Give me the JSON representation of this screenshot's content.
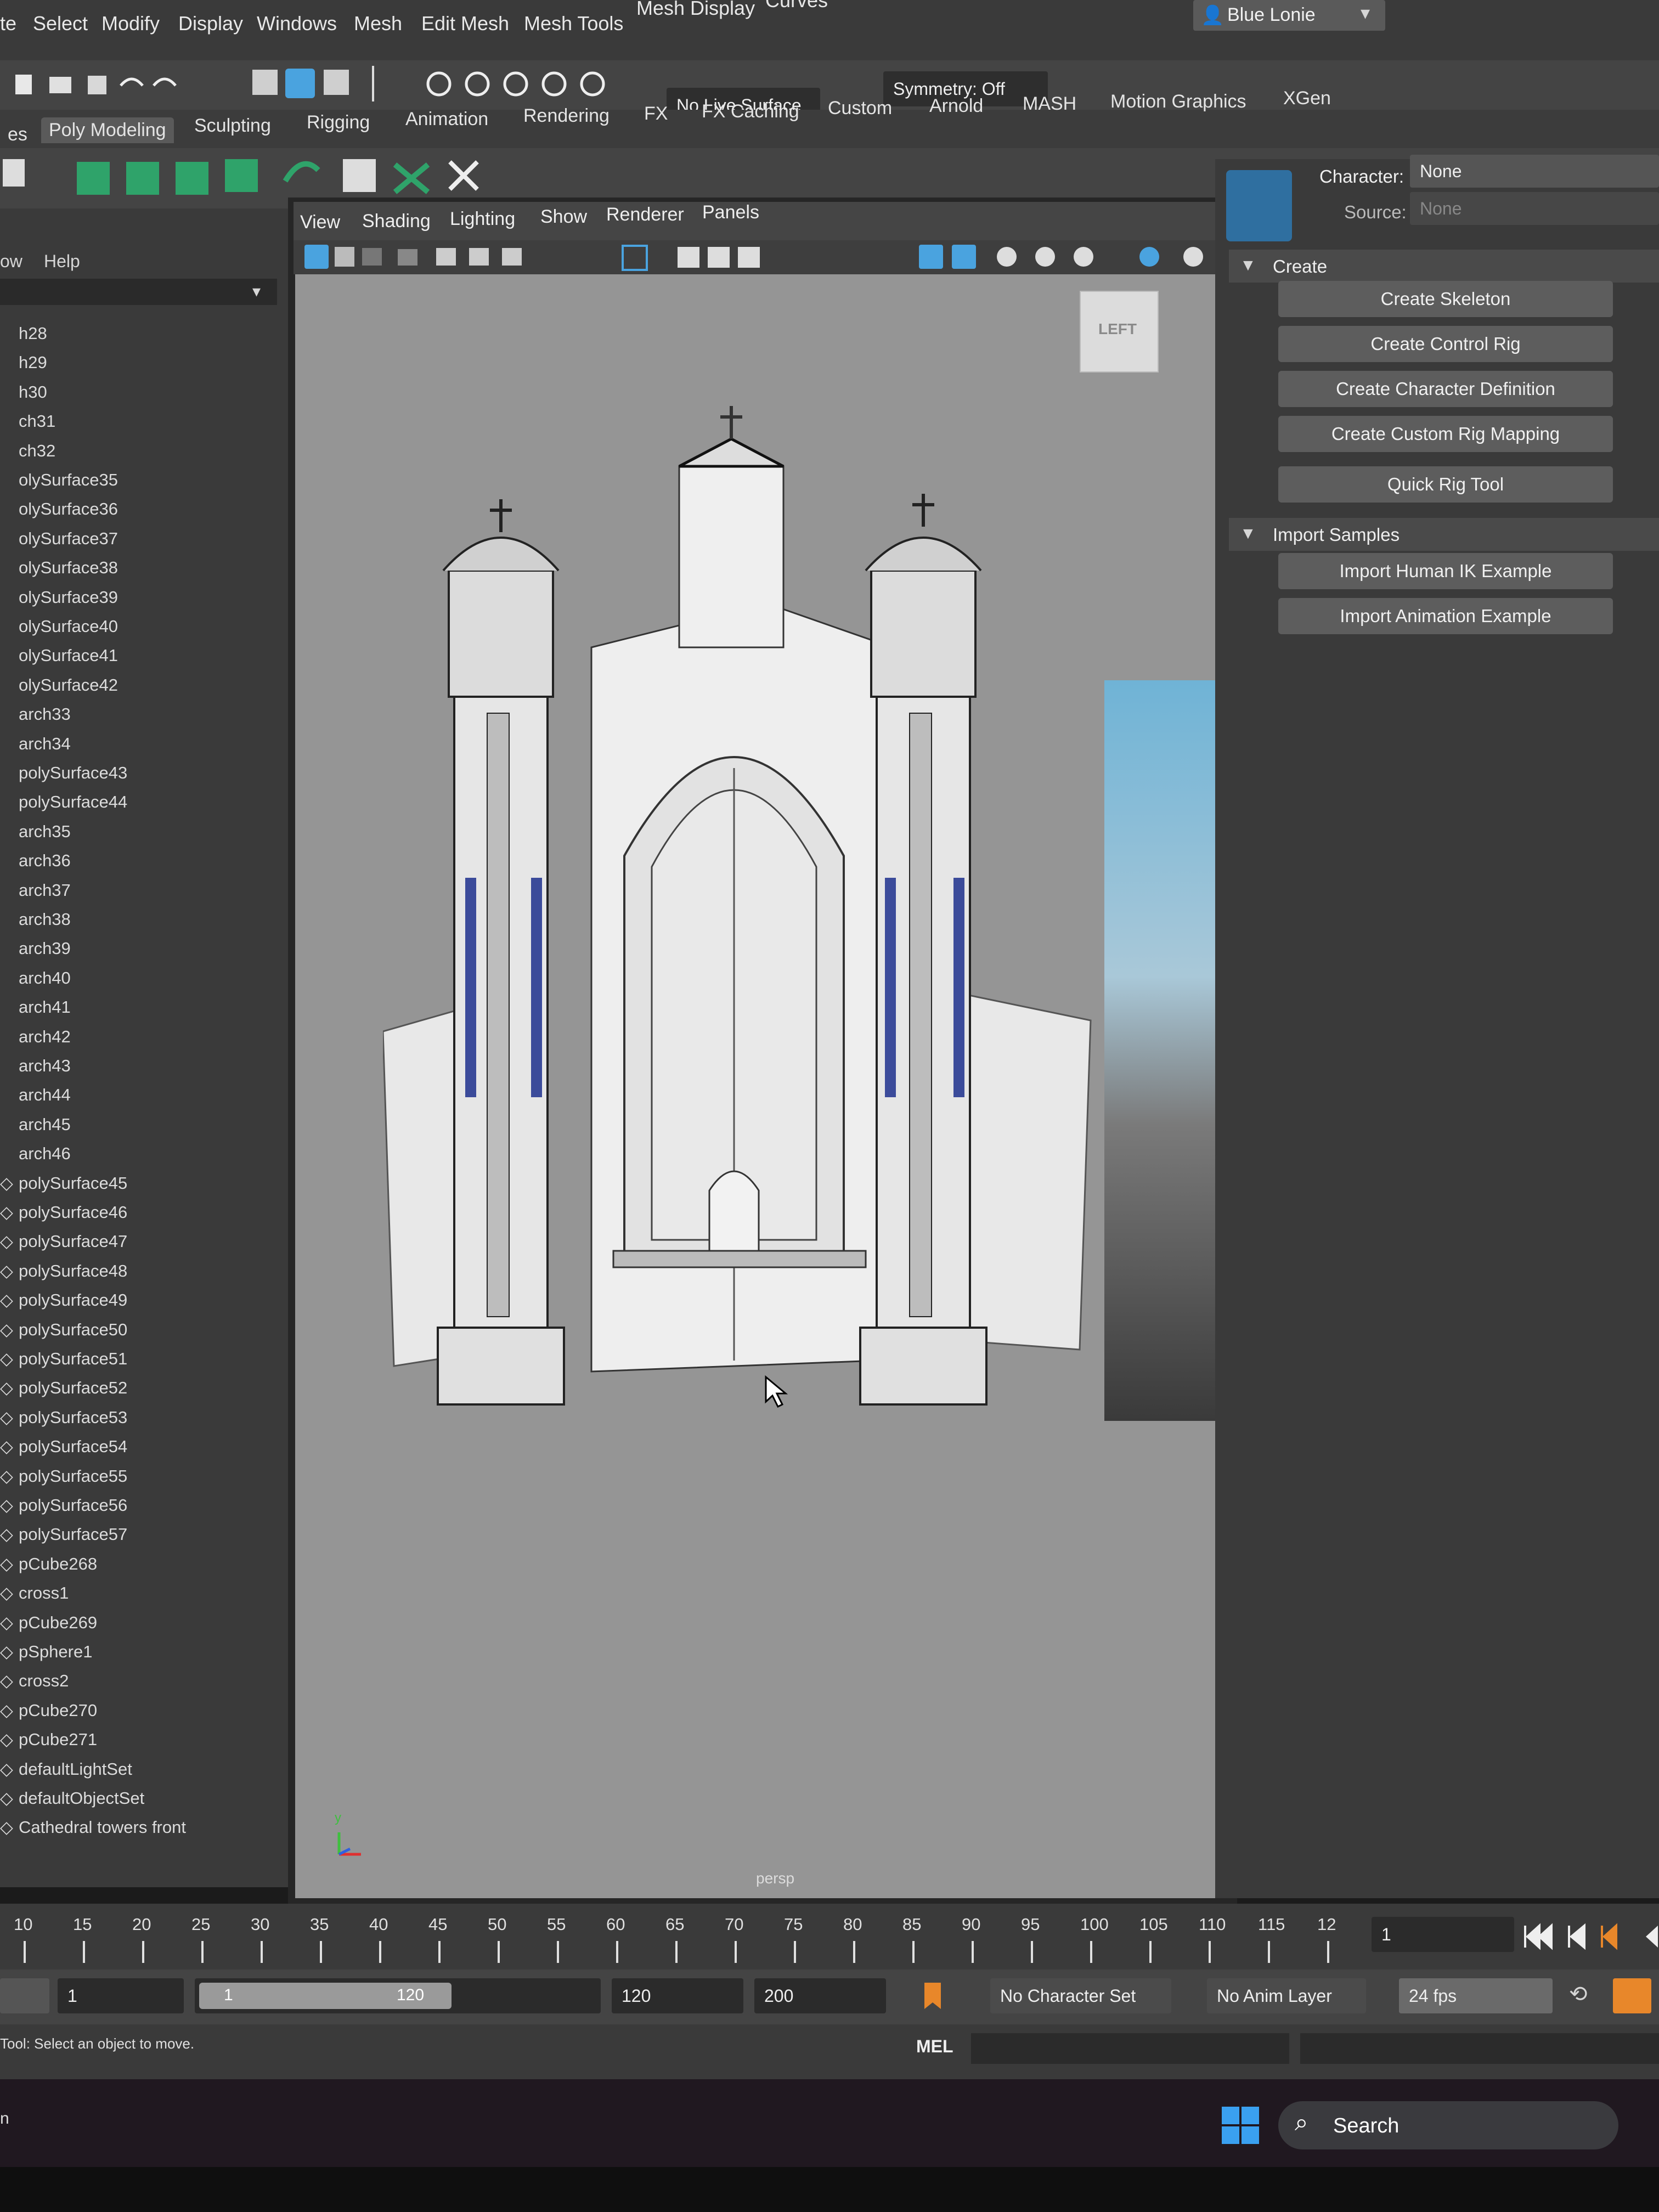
{
  "menubar": {
    "items": [
      "te",
      "Select",
      "Modify",
      "Display",
      "Windows",
      "Mesh",
      "Edit Mesh",
      "Mesh Tools",
      "Mesh Display",
      "Curves"
    ],
    "account": "Blue Lonie"
  },
  "statusline": {
    "live_surface": "No Live Surface",
    "symmetry": "Symmetry: Off"
  },
  "shelf": {
    "tabs": [
      "es",
      "Poly Modeling",
      "Sculpting",
      "Rigging",
      "Animation",
      "Rendering",
      "FX",
      "FX Caching",
      "Custom",
      "Arnold",
      "MASH",
      "Motion Graphics",
      "XGen"
    ],
    "active_tab": "Poly Modeling"
  },
  "outliner": {
    "menu": [
      "ow",
      "Help"
    ],
    "items": [
      "h28",
      "h29",
      "h30",
      "ch31",
      "ch32",
      "olySurface35",
      "olySurface36",
      "olySurface37",
      "olySurface38",
      "olySurface39",
      "olySurface40",
      "olySurface41",
      "olySurface42",
      "arch33",
      "arch34",
      "polySurface43",
      "polySurface44",
      "arch35",
      "arch36",
      "arch37",
      "arch38",
      "arch39",
      "arch40",
      "arch41",
      "arch42",
      "arch43",
      "arch44",
      "arch45",
      "arch46",
      "polySurface45",
      "polySurface46",
      "polySurface47",
      "polySurface48",
      "polySurface49",
      "polySurface50",
      "polySurface51",
      "polySurface52",
      "polySurface53",
      "polySurface54",
      "polySurface55",
      "polySurface56",
      "polySurface57",
      "pCube268",
      "cross1",
      "pCube269",
      "pSphere1",
      "cross2",
      "pCube270",
      "pCube271",
      "defaultLightSet",
      "defaultObjectSet",
      "Cathedral towers front"
    ]
  },
  "viewport": {
    "menu": [
      "View",
      "Shading",
      "Lighting",
      "Show",
      "Renderer",
      "Panels"
    ],
    "view_cube_label": "LEFT",
    "camera_label": "persp",
    "axis_label": "y"
  },
  "character_panel": {
    "character_label": "Character:",
    "character_value": "None",
    "source_label": "Source:",
    "source_value": "None",
    "create_section": "Create",
    "create_buttons": [
      "Create Skeleton",
      "Create Control Rig",
      "Create Character Definition",
      "Create Custom Rig Mapping",
      "Quick Rig Tool"
    ],
    "import_section": "Import Samples",
    "import_buttons": [
      "Import Human IK Example",
      "Import Animation Example"
    ]
  },
  "timeline": {
    "ticks": [
      "10",
      "15",
      "20",
      "25",
      "30",
      "35",
      "40",
      "45",
      "50",
      "55",
      "60",
      "65",
      "70",
      "75",
      "80",
      "85",
      "90",
      "95",
      "100",
      "105",
      "110",
      "115",
      "12"
    ],
    "current_frame": "1"
  },
  "range": {
    "start": "1",
    "slider_start": "1",
    "slider_end": "120",
    "end": "120",
    "max": "200",
    "character_set": "No Character Set",
    "anim_layer": "No Anim Layer",
    "fps": "24 fps"
  },
  "commandline": {
    "help_text": "Tool: Select an object to move.",
    "language": "MEL"
  },
  "taskbar": {
    "search_label": "Search",
    "left_fragment": "n"
  },
  "colors": {
    "ui_dark": "#3a3a3a",
    "viewport_bg": "#959595",
    "accent_blue": "#4aa3df",
    "key_orange": "#e8872a"
  }
}
